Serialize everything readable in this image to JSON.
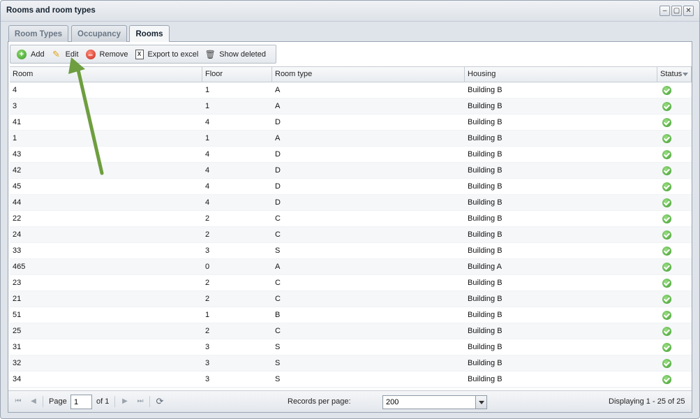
{
  "window": {
    "title": "Rooms and room types",
    "controls": [
      "minimize-icon",
      "maximize-icon",
      "close-icon"
    ]
  },
  "tabs": [
    {
      "label": "Room Types",
      "active": false
    },
    {
      "label": "Occupancy",
      "active": false
    },
    {
      "label": "Rooms",
      "active": true
    }
  ],
  "toolbar": {
    "add_label": "Add",
    "edit_label": "Edit",
    "remove_label": "Remove",
    "export_label": "Export to excel",
    "show_deleted_label": "Show deleted"
  },
  "grid": {
    "columns": [
      "Room",
      "Floor",
      "Room type",
      "Housing",
      "Status"
    ],
    "sorted_column": "Status",
    "rows": [
      {
        "room": "4",
        "floor": "1",
        "type": "A",
        "housing": "Building B",
        "status": "ok-icon"
      },
      {
        "room": "3",
        "floor": "1",
        "type": "A",
        "housing": "Building B",
        "status": "ok-icon"
      },
      {
        "room": "41",
        "floor": "4",
        "type": "D",
        "housing": "Building B",
        "status": "ok-icon"
      },
      {
        "room": "1",
        "floor": "1",
        "type": "A",
        "housing": "Building B",
        "status": "ok-icon"
      },
      {
        "room": "43",
        "floor": "4",
        "type": "D",
        "housing": "Building B",
        "status": "ok-icon"
      },
      {
        "room": "42",
        "floor": "4",
        "type": "D",
        "housing": "Building B",
        "status": "ok-icon"
      },
      {
        "room": "45",
        "floor": "4",
        "type": "D",
        "housing": "Building B",
        "status": "ok-icon"
      },
      {
        "room": "44",
        "floor": "4",
        "type": "D",
        "housing": "Building B",
        "status": "ok-icon"
      },
      {
        "room": "22",
        "floor": "2",
        "type": "C",
        "housing": "Building B",
        "status": "ok-icon"
      },
      {
        "room": "24",
        "floor": "2",
        "type": "C",
        "housing": "Building B",
        "status": "ok-icon"
      },
      {
        "room": "33",
        "floor": "3",
        "type": "S",
        "housing": "Building B",
        "status": "ok-icon"
      },
      {
        "room": "465",
        "floor": "0",
        "type": "A",
        "housing": "Building A",
        "status": "ok-icon"
      },
      {
        "room": "23",
        "floor": "2",
        "type": "C",
        "housing": "Building B",
        "status": "ok-icon"
      },
      {
        "room": "21",
        "floor": "2",
        "type": "C",
        "housing": "Building B",
        "status": "ok-icon"
      },
      {
        "room": "51",
        "floor": "1",
        "type": "B",
        "housing": "Building B",
        "status": "ok-icon"
      },
      {
        "room": "25",
        "floor": "2",
        "type": "C",
        "housing": "Building B",
        "status": "ok-icon"
      },
      {
        "room": "31",
        "floor": "3",
        "type": "S",
        "housing": "Building B",
        "status": "ok-icon"
      },
      {
        "room": "32",
        "floor": "3",
        "type": "S",
        "housing": "Building B",
        "status": "ok-icon"
      },
      {
        "room": "34",
        "floor": "3",
        "type": "S",
        "housing": "Building B",
        "status": "ok-icon"
      },
      {
        "room": "",
        "floor": "",
        "type": "",
        "housing": "",
        "status": "ok-icon"
      }
    ]
  },
  "pager": {
    "page_label": "Page",
    "page_value": "1",
    "of_label": "of 1",
    "records_label": "Records per page:",
    "records_value": "200",
    "display_text": "Displaying 1 - 25 of 25"
  },
  "annotation": {
    "arrow_color": "#6e9e3f"
  }
}
